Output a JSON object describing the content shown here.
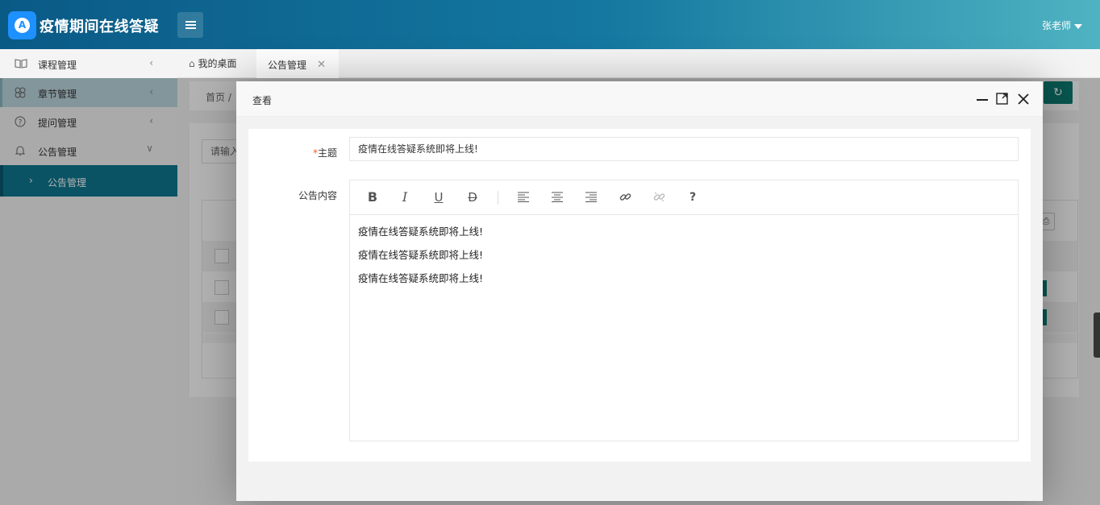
{
  "header": {
    "logo_letter": "A",
    "app_title": "疫情期间在线答疑",
    "user_name": "张老师"
  },
  "sidebar": {
    "items": [
      {
        "label": "课程管理",
        "icon": "book-icon",
        "state": "collapsed"
      },
      {
        "label": "章节管理",
        "icon": "clover-icon",
        "state": "collapsed"
      },
      {
        "label": "提问管理",
        "icon": "question-circle-icon",
        "state": "collapsed"
      },
      {
        "label": "公告管理",
        "icon": "bell-icon",
        "state": "expanded"
      }
    ],
    "active_sub": {
      "label": "公告管理"
    }
  },
  "tabs": [
    {
      "label": "我的桌面",
      "icon": "home-icon"
    },
    {
      "label": "公告管理",
      "closable": true
    }
  ],
  "background": {
    "breadcrumb": "首页 /",
    "search_placeholder": "请输入"
  },
  "modal": {
    "title": "查看",
    "fields": {
      "subject_label": "主题",
      "subject_required_mark": "*",
      "subject_value": "疫情在线答疑系统即将上线!",
      "content_label": "公告内容"
    },
    "toolbar": [
      {
        "name": "bold-icon",
        "glyph": "B"
      },
      {
        "name": "italic-icon",
        "glyph": "I"
      },
      {
        "name": "underline-icon",
        "glyph": "U"
      },
      {
        "name": "strikethrough-icon",
        "glyph": "D"
      },
      {
        "name": "align-left-icon"
      },
      {
        "name": "align-center-icon"
      },
      {
        "name": "align-right-icon"
      },
      {
        "name": "link-icon"
      },
      {
        "name": "unlink-icon"
      },
      {
        "name": "help-icon",
        "glyph": "?"
      }
    ],
    "content_lines": [
      "疫情在线答疑系统即将上线!",
      "疫情在线答疑系统即将上线!",
      "疫情在线答疑系统即将上线!"
    ]
  },
  "colors": {
    "accent": "#0e7790",
    "primary_button": "#0e7a72",
    "required": "#ff5722"
  }
}
